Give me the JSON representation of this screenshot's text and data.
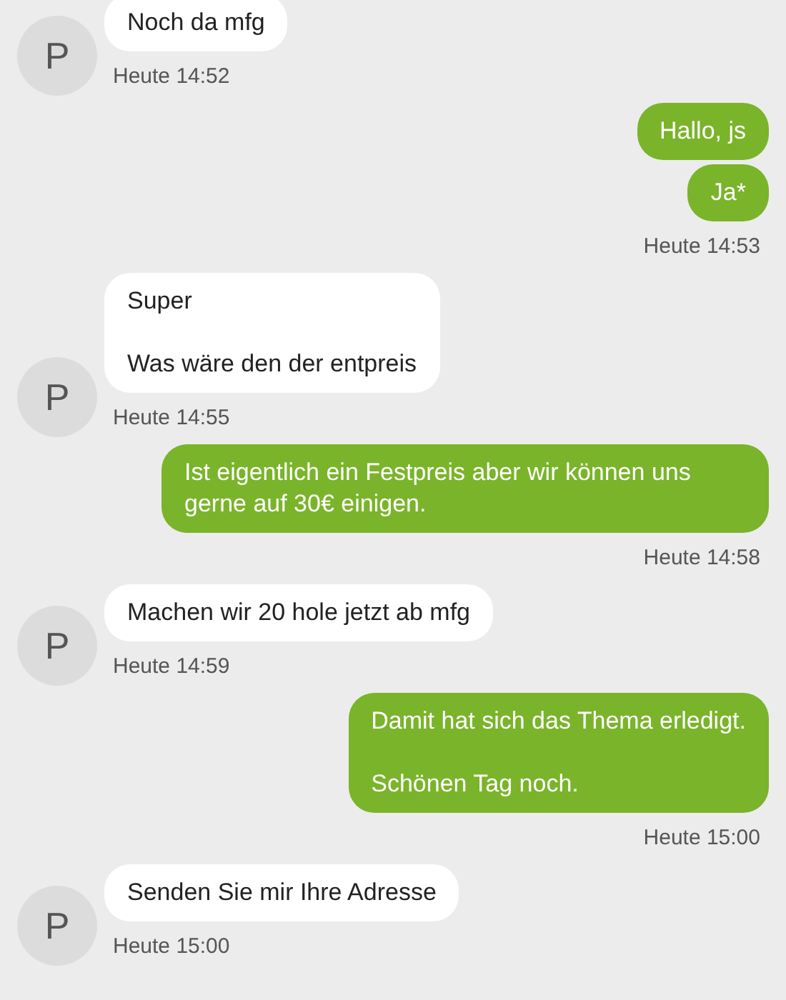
{
  "conversation": [
    {
      "kind": "received",
      "avatar": "P",
      "messages": [
        {
          "paragraphs": [
            "Noch da mfg"
          ]
        }
      ],
      "time": "Heute 14:52"
    },
    {
      "kind": "sent",
      "messages": [
        {
          "paragraphs": [
            "Hallo, js"
          ]
        },
        {
          "paragraphs": [
            "Ja*"
          ]
        }
      ],
      "time": "Heute 14:53"
    },
    {
      "kind": "received",
      "avatar": "P",
      "messages": [
        {
          "paragraphs": [
            "Super",
            "Was wäre den der entpreis"
          ]
        }
      ],
      "time": "Heute 14:55"
    },
    {
      "kind": "sent",
      "messages": [
        {
          "paragraphs": [
            "Ist eigentlich ein Festpreis aber wir können uns gerne auf 30€ einigen."
          ]
        }
      ],
      "time": "Heute 14:58"
    },
    {
      "kind": "received",
      "avatar": "P",
      "messages": [
        {
          "paragraphs": [
            "Machen wir 20 hole jetzt ab mfg"
          ]
        }
      ],
      "time": "Heute 14:59"
    },
    {
      "kind": "sent",
      "messages": [
        {
          "paragraphs": [
            "Damit hat sich das Thema erledigt.",
            "Schönen Tag noch."
          ]
        }
      ],
      "time": "Heute 15:00"
    },
    {
      "kind": "received",
      "avatar": "P",
      "messages": [
        {
          "paragraphs": [
            "Senden Sie mir Ihre Adresse"
          ]
        }
      ],
      "time": "Heute 15:00"
    }
  ]
}
